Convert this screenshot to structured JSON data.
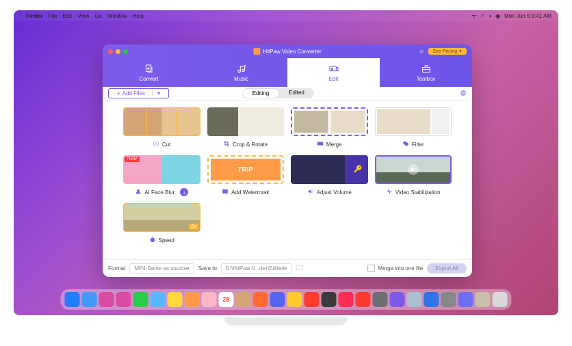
{
  "menubar": {
    "app": "Finder",
    "items": [
      "File",
      "Edit",
      "View",
      "Go",
      "Window",
      "Help"
    ],
    "datetime": "Mon Jun 5  9:41 AM"
  },
  "window": {
    "title": "HitPaw Video Converter",
    "pricing": "See Pricing"
  },
  "tabs": [
    {
      "id": "convert",
      "label": "Convert"
    },
    {
      "id": "music",
      "label": "Music"
    },
    {
      "id": "edit",
      "label": "Edit",
      "active": true
    },
    {
      "id": "toolbox",
      "label": "Toolbox"
    }
  ],
  "subbar": {
    "addfiles": "Add Files",
    "subtabs": [
      {
        "label": "Editing",
        "active": true
      },
      {
        "label": "Edited"
      }
    ]
  },
  "tools": [
    {
      "id": "cut",
      "label": "Cut",
      "thumb": "th-cut"
    },
    {
      "id": "crop",
      "label": "Crop & Rotate",
      "thumb": "th-crop"
    },
    {
      "id": "merge",
      "label": "Merge",
      "thumb": "th-merge"
    },
    {
      "id": "filter",
      "label": "Filter",
      "thumb": "th-filter"
    },
    {
      "id": "face",
      "label": "AI Face Blur",
      "thumb": "th-face",
      "new": true,
      "download": true
    },
    {
      "id": "watermark",
      "label": "Add Watermrak",
      "thumb": "th-water"
    },
    {
      "id": "volume",
      "label": "Adjust Volume",
      "thumb": "th-vol"
    },
    {
      "id": "stab",
      "label": "Video Stabilization",
      "thumb": "th-stab"
    },
    {
      "id": "speed",
      "label": "Speed",
      "thumb": "th-speed"
    }
  ],
  "bottombar": {
    "formatLabel": "Format",
    "formatValue": "MP4-Same as source",
    "saveLabel": "Save to",
    "saveValue": "D:\\HitPaw V...rter\\Edited",
    "mergeCheck": "Merge into one file",
    "export": "Export All"
  },
  "dock_colors": [
    "#1e7fff",
    "#3e9af5",
    "#d94ca5",
    "#d94ca5",
    "#29cc4a",
    "#59b7ff",
    "#ffd93b",
    "#ff9b47",
    "#fcb6c8",
    "#fff",
    "#d4a574",
    "#ff6b35",
    "#5865f2",
    "#ffcb2b",
    "#ff3b30",
    "#3a3a3c",
    "#ff2d55",
    "#ff3b30",
    "#6e6e73",
    "#7d5de8",
    "#abc0d0",
    "#3074e8",
    "#888",
    "#6e6ef0",
    "#c8c0a8",
    "#d8d8d8"
  ]
}
